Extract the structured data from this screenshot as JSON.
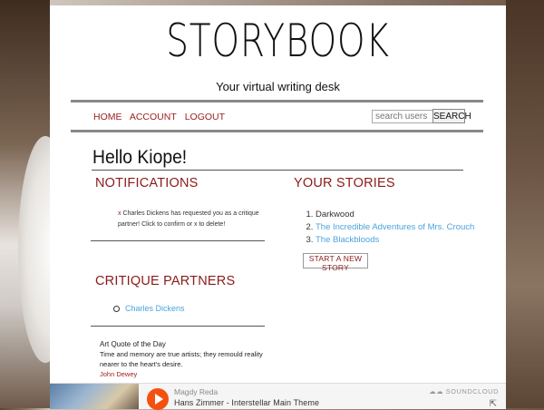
{
  "site": {
    "title": "STORYBOOK",
    "tagline": "Your virtual writing desk"
  },
  "nav": {
    "items": [
      "HOME",
      "ACCOUNT",
      "LOGOUT"
    ]
  },
  "search": {
    "placeholder": "search users",
    "button": "SEARCH"
  },
  "greeting": "Hello Kiope!",
  "notifications": {
    "title": "NOTIFICATIONS",
    "items": [
      {
        "x": "x",
        "text": " Charles Dickens has requested you as a critique partner! Click to confirm or x to delete!"
      }
    ]
  },
  "stories": {
    "title": "YOUR STORIES",
    "items": [
      "Darkwood",
      "The Incredible Adventures of Mrs. Crouch",
      "The Blackbloods"
    ],
    "new_button": "START A NEW STORY"
  },
  "partners": {
    "title": "CRITIQUE PARTNERS",
    "items": [
      "Charles Dickens"
    ]
  },
  "quote": {
    "title": "Art Quote of the Day",
    "text": "Time and memory are true artists; they remould reality nearer to the heart's desire.",
    "author": "John Dewey"
  },
  "player": {
    "artist": "Magdy Reda",
    "track": "Hans Zimmer - Interstellar Main Theme",
    "brand": "SOUNDCLOUD",
    "icons": {
      "play": "play-icon",
      "share": "share-icon"
    },
    "accent": "#f5500f"
  },
  "colors": {
    "heading": "#8b1a1a",
    "link": "#4aa3df",
    "nav": "#9b1c1c"
  }
}
